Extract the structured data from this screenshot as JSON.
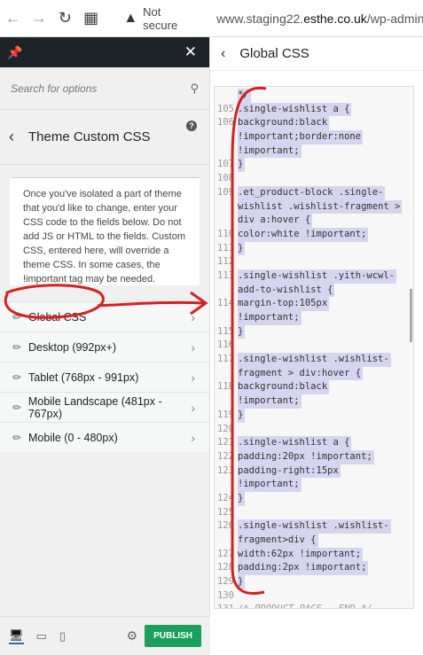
{
  "browser": {
    "security_label": "Not secure",
    "url_host": "www.staging22.",
    "url_domain": "esthe.co.uk",
    "url_path": "/wp-admin/"
  },
  "sidebar": {
    "search_placeholder": "Search for options",
    "section_title": "Theme Custom CSS",
    "help": "?",
    "description": "Once you've isolated a part of theme that you'd like to change, enter your CSS code to the fields below. Do not add JS or HTML to the fields. Custom CSS, entered here, will override a theme CSS. In some cases, the !important tag may be needed.",
    "items": [
      {
        "label": "Global CSS"
      },
      {
        "label": "Desktop (992px+)"
      },
      {
        "label": "Tablet (768px - 991px)"
      },
      {
        "label": "Mobile Landscape (481px - 767px)"
      },
      {
        "label": "Mobile (0 - 480px)"
      }
    ],
    "publish_label": "PUBLISH"
  },
  "editor": {
    "title": "Global CSS",
    "lines": [
      {
        "n": "",
        "t": "*/"
      },
      {
        "n": "105",
        "t": ".single-wishlist a {"
      },
      {
        "n": "106",
        "t": "    background:black"
      },
      {
        "n": "",
        "t": "!important;border:none"
      },
      {
        "n": "",
        "t": "!important;"
      },
      {
        "n": "107",
        "t": "}"
      },
      {
        "n": "108",
        "t": ""
      },
      {
        "n": "109",
        "t": ".et_product-block .single-"
      },
      {
        "n": "",
        "t": "wishlist .wishlist-fragment >"
      },
      {
        "n": "",
        "t": "div a:hover {"
      },
      {
        "n": "110",
        "t": "    color:white !important;"
      },
      {
        "n": "111",
        "t": "}"
      },
      {
        "n": "112",
        "t": ""
      },
      {
        "n": "113",
        "t": ".single-wishlist .yith-wcwl-"
      },
      {
        "n": "",
        "t": "add-to-wishlist {"
      },
      {
        "n": "114",
        "t": "    margin-top:105px"
      },
      {
        "n": "",
        "t": "!important;"
      },
      {
        "n": "115",
        "t": "}"
      },
      {
        "n": "116",
        "t": ""
      },
      {
        "n": "117",
        "t": ".single-wishlist .wishlist-"
      },
      {
        "n": "",
        "t": "fragment > div:hover {"
      },
      {
        "n": "118",
        "t": "    background:black"
      },
      {
        "n": "",
        "t": "!important;"
      },
      {
        "n": "119",
        "t": "}"
      },
      {
        "n": "120",
        "t": ""
      },
      {
        "n": "121",
        "t": ".single-wishlist a {"
      },
      {
        "n": "122",
        "t": "    padding:20px !important;"
      },
      {
        "n": "123",
        "t": "    padding-right:15px"
      },
      {
        "n": "",
        "t": "!important;"
      },
      {
        "n": "124",
        "t": "}"
      },
      {
        "n": "125",
        "t": ""
      },
      {
        "n": "126",
        "t": ".single-wishlist .wishlist-"
      },
      {
        "n": "",
        "t": "fragment>div {"
      },
      {
        "n": "127",
        "t": "    width:62px !important;"
      },
      {
        "n": "128",
        "t": "    padding:2px !important;"
      },
      {
        "n": "129",
        "t": "}"
      },
      {
        "n": "130",
        "t": ""
      },
      {
        "n": "131",
        "t": "/* PRODUCT PAGE - END */",
        "plain": true
      }
    ]
  },
  "colors": {
    "publish": "#1aa05a",
    "annotation": "#d62020",
    "selection": "#d7d4f0"
  }
}
